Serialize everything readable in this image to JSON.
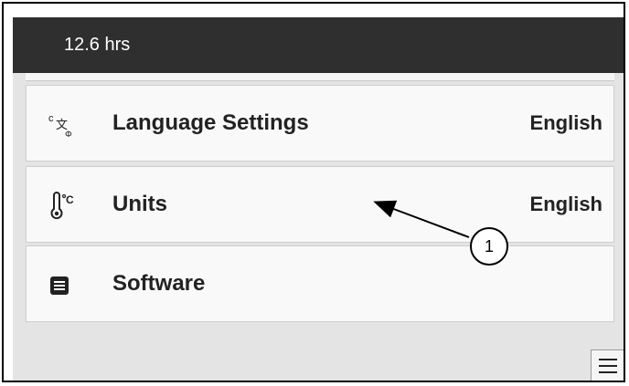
{
  "header": {
    "usage": "12.6 hrs"
  },
  "settings": [
    {
      "icon": "language-icon",
      "label": "Language Settings",
      "value": "English"
    },
    {
      "icon": "thermometer-icon",
      "label": "Units",
      "value": "English"
    },
    {
      "icon": "software-icon",
      "label": "Software",
      "value": ""
    }
  ],
  "callout": {
    "number": "1"
  },
  "menu": {
    "icon": "hamburger-menu-icon"
  }
}
